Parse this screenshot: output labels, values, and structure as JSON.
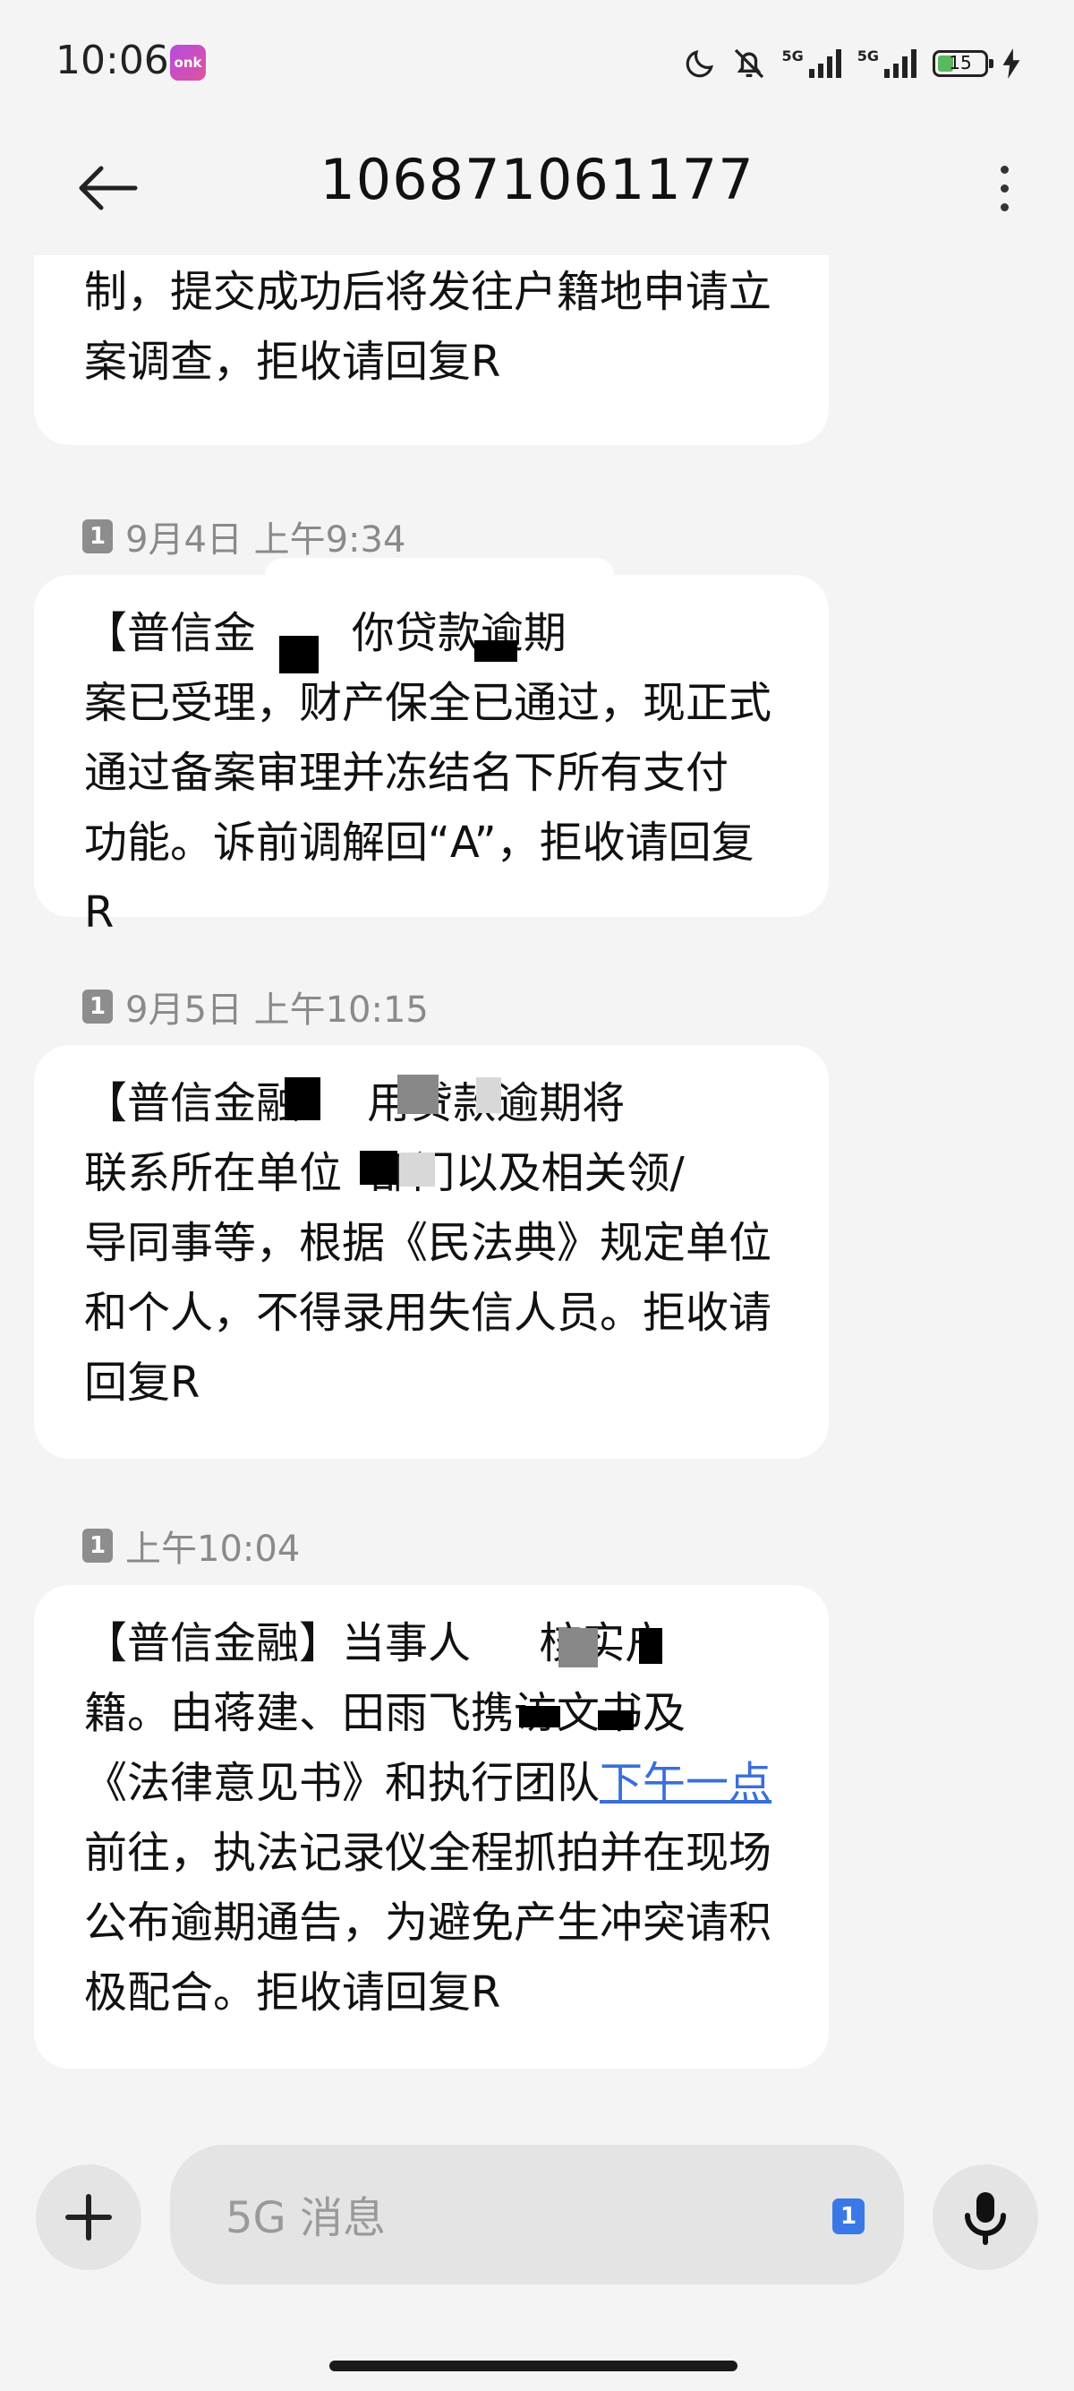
{
  "status_bar": {
    "time": "10:06",
    "app_badge": "onk",
    "signal1": "5G",
    "signal2": "5G",
    "battery": "15"
  },
  "header": {
    "title": "106871061177"
  },
  "messages": [
    {
      "text_parts": [
        "制，提交成功后将发往户籍地申请立\n案调查，拒收请回复R"
      ]
    },
    {
      "sim": "1",
      "time": "9月4日 上午9:34",
      "text_parts": [
        "【普信金",
        "       你贷款逾期\n案已受理，财产保全已通过，现正式\n通过备案审理并冻结名下所有支付\n功能。诉前调解回“A”，拒收请回复R"
      ]
    },
    {
      "sim": "1",
      "time": "9月5日 上午10:15",
      "text_parts": [
        "【普信金融",
        "     用贷款逾期将\n联系所在单位",
        "部门以及相关领/\n导同事等，根据《民法典》规定单位\n和个人，不得录用失信人员。拒收请\n回复R"
      ]
    },
    {
      "sim": "1",
      "time": "上午10:04",
      "text_parts": [
        "【普信金融】当事人",
        "     核实户\n籍。由蒋建、田雨飞携",
        "访文书及\n《法律意见书》和执行团队",
        "下午一点",
        "\n前往，执法记录仪全程抓拍并在现场\n公布逾期通告，为避免产生冲突请积\n极配合。拒收请回复R"
      ]
    }
  ],
  "input": {
    "placeholder": "5G 消息",
    "sim": "1"
  },
  "icons": {
    "back": "arrow-left-icon",
    "more": "more-vertical-icon",
    "add": "plus-icon",
    "mic": "microphone-icon"
  }
}
